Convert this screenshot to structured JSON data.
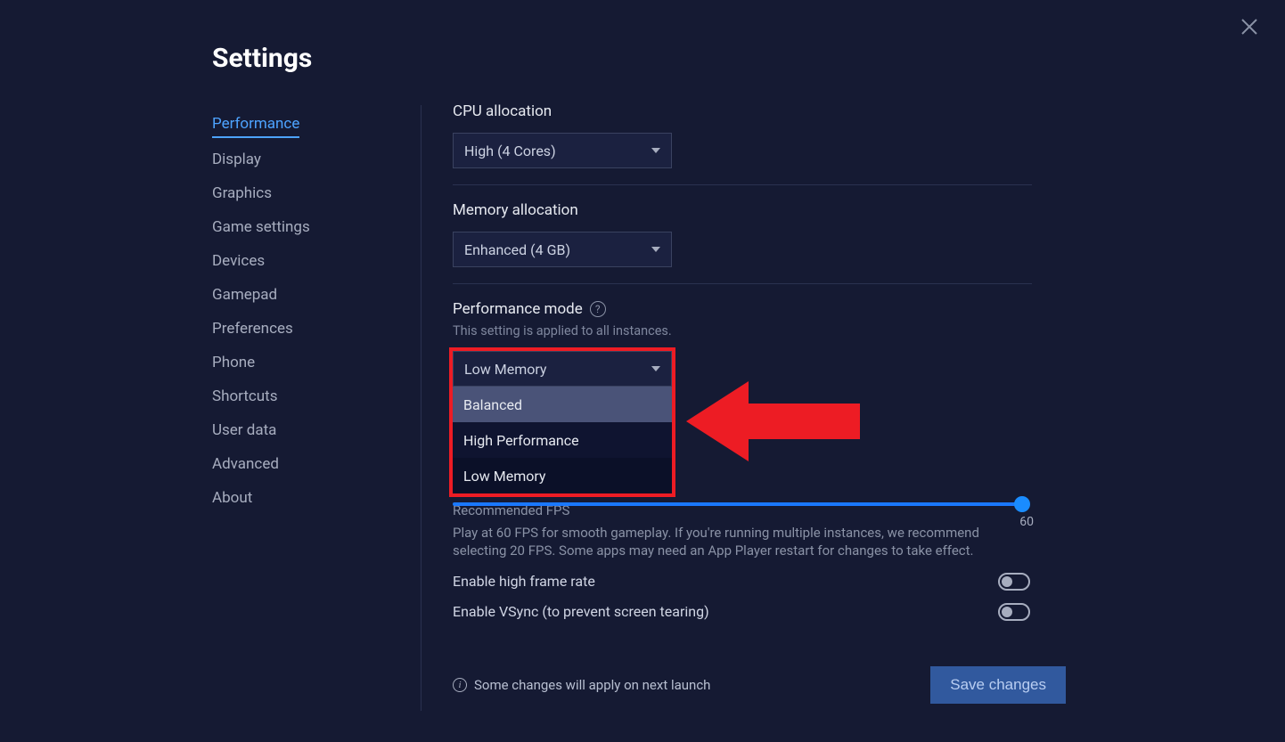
{
  "title": "Settings",
  "sidebar": {
    "items": [
      {
        "label": "Performance",
        "active": true
      },
      {
        "label": "Display"
      },
      {
        "label": "Graphics"
      },
      {
        "label": "Game settings"
      },
      {
        "label": "Devices"
      },
      {
        "label": "Gamepad"
      },
      {
        "label": "Preferences"
      },
      {
        "label": "Phone"
      },
      {
        "label": "Shortcuts"
      },
      {
        "label": "User data"
      },
      {
        "label": "Advanced"
      },
      {
        "label": "About"
      }
    ]
  },
  "cpu": {
    "label": "CPU allocation",
    "value": "High (4 Cores)"
  },
  "memory": {
    "label": "Memory allocation",
    "value": "Enhanced (4 GB)"
  },
  "perf_mode": {
    "label": "Performance mode",
    "subtext": "This setting is applied to all instances.",
    "value": "Low Memory",
    "options": [
      "Balanced",
      "High Performance",
      "Low Memory"
    ]
  },
  "fps": {
    "value": "60",
    "rec_title": "Recommended FPS",
    "rec_text": "Play at 60 FPS for smooth gameplay. If you're running multiple instances, we recommend selecting 20 FPS. Some apps may need an App Player restart for changes to take effect."
  },
  "toggles": {
    "high_frame": "Enable high frame rate",
    "vsync": "Enable VSync (to prevent screen tearing)"
  },
  "footer": {
    "note": "Some changes will apply on next launch",
    "save": "Save changes"
  }
}
